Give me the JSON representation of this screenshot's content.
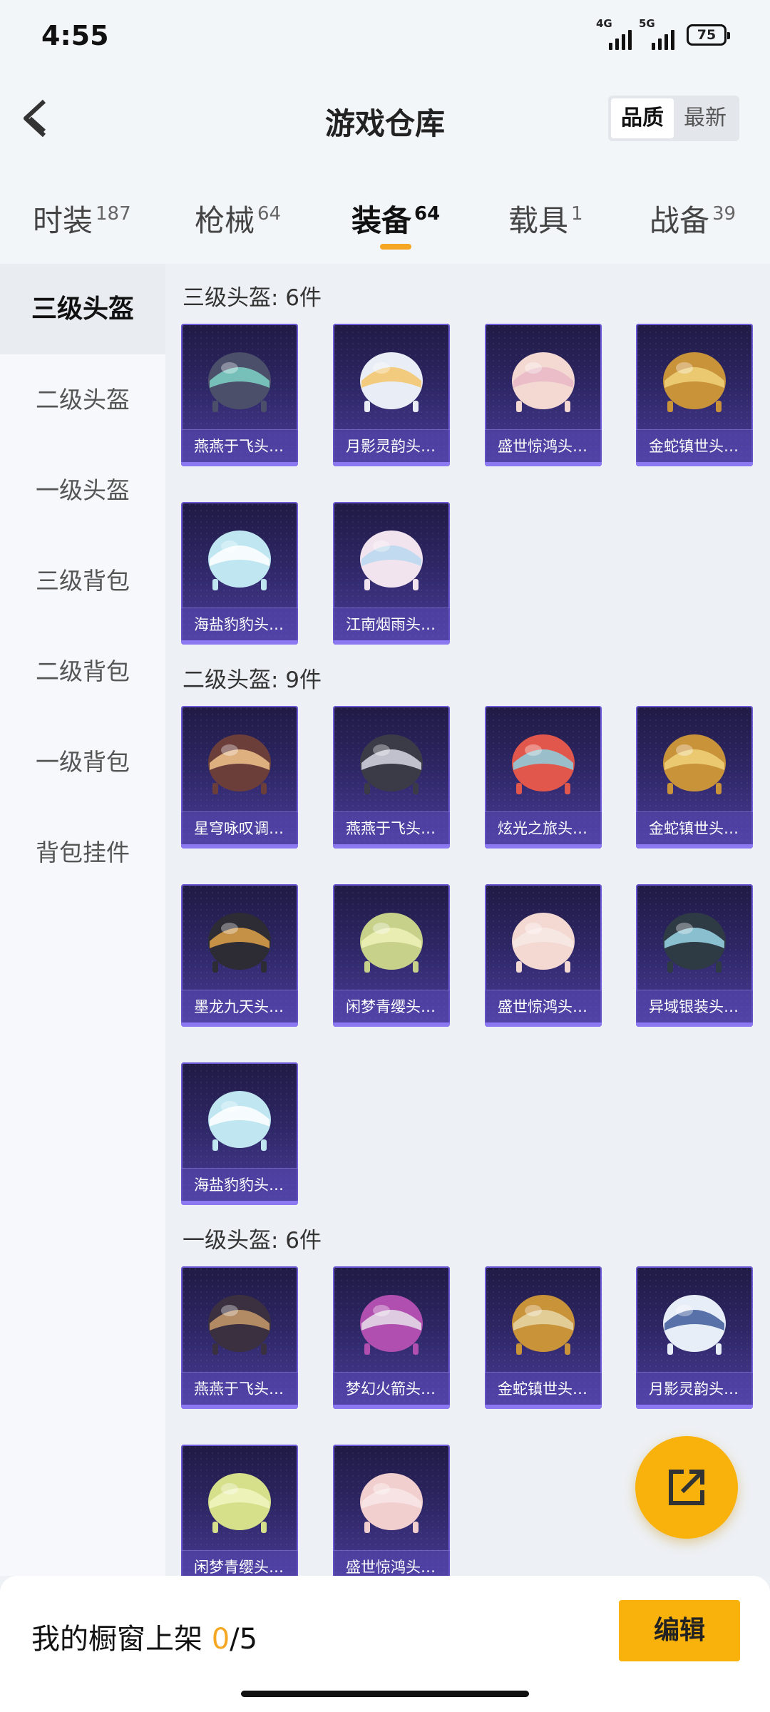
{
  "status": {
    "time": "4:55",
    "net1": "4G",
    "net2": "5G",
    "battery": "75"
  },
  "header": {
    "title": "游戏仓库",
    "sort_quality": "品质",
    "sort_newest": "最新"
  },
  "tabs": [
    {
      "label": "时装",
      "count": "187"
    },
    {
      "label": "枪械",
      "count": "64"
    },
    {
      "label": "装备",
      "count": "64"
    },
    {
      "label": "载具",
      "count": "1"
    },
    {
      "label": "战备",
      "count": "39"
    }
  ],
  "sidebar": [
    "三级头盔",
    "二级头盔",
    "一级头盔",
    "三级背包",
    "二级背包",
    "一级背包",
    "背包挂件"
  ],
  "sections": [
    {
      "title": "三级头盔: 6件",
      "items": [
        "燕燕于飞头…",
        "月影灵韵头…",
        "盛世惊鸿头…",
        "金蛇镇世头…",
        "海盐豹豹头…",
        "江南烟雨头…"
      ]
    },
    {
      "title": "二级头盔: 9件",
      "items": [
        "星穹咏叹调…",
        "燕燕于飞头…",
        "炫光之旅头…",
        "金蛇镇世头…",
        "墨龙九天头…",
        "闲梦青缨头…",
        "盛世惊鸿头…",
        "异域银装头…",
        "海盐豹豹头…"
      ]
    },
    {
      "title": "一级头盔: 6件",
      "items": [
        "燕燕于飞头…",
        "梦幻火箭头…",
        "金蛇镇世头…",
        "月影灵韵头…",
        "闲梦青缨头…",
        "盛世惊鸿头…"
      ]
    }
  ],
  "bottom": {
    "label": "我的橱窗上架 ",
    "current": "0",
    "total": "/5",
    "edit": "编辑"
  },
  "colors": {
    "accent": "#f9b20b",
    "underline": "#f5a623",
    "card_top": "#201a44",
    "card_bottom": "#4a3d9a"
  }
}
